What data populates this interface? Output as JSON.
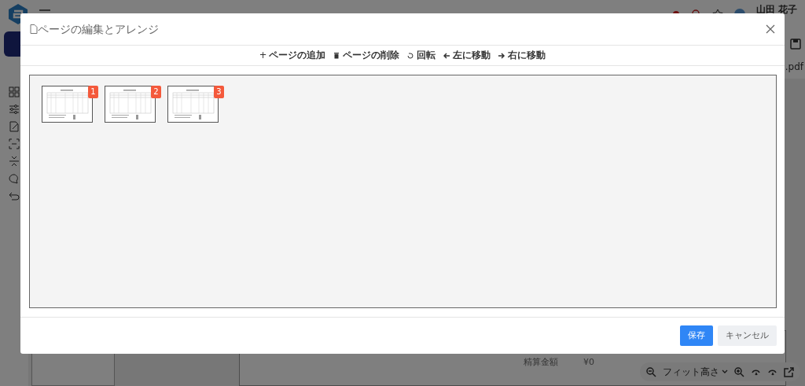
{
  "background": {
    "user_name": "山田 花子",
    "file_name": ".pdf",
    "total_label": "精算金額",
    "total_value": "¥0",
    "zoom_mode": "フィット高さ"
  },
  "dialog": {
    "title": "ページの編集とアレンジ",
    "toolbar": [
      {
        "kind": "add",
        "icon_char": "+",
        "label": "ページの追加"
      },
      {
        "kind": "delete",
        "label": "ページの削除"
      },
      {
        "kind": "rotate",
        "label": "回転"
      },
      {
        "kind": "left",
        "label": "左に移動"
      },
      {
        "kind": "right",
        "label": "右に移動"
      }
    ],
    "pages": [
      {
        "number": "1"
      },
      {
        "number": "2"
      },
      {
        "number": "3"
      }
    ],
    "buttons": [
      {
        "kind": "primary",
        "label": "保存"
      },
      {
        "kind": "secondary",
        "label": "キャンセル"
      }
    ]
  }
}
